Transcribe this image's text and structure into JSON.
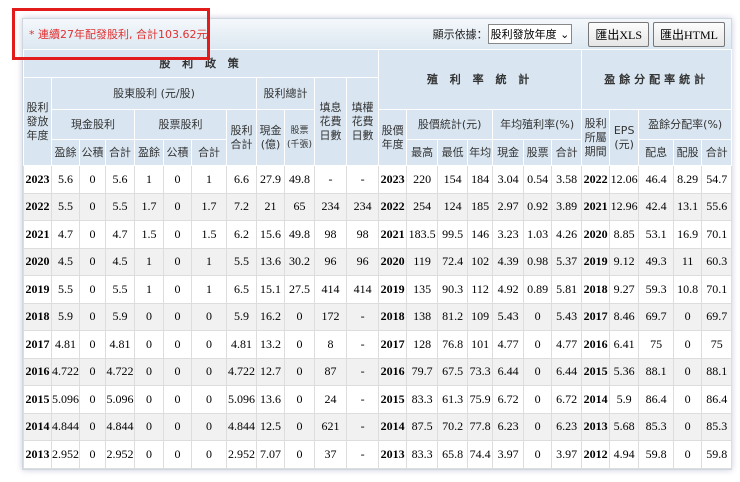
{
  "note": "* 連續27年配發股利, 合計103.62元",
  "display_label": "顯示依據：",
  "display_value": "股利發放年度",
  "btn_xls": "匯出XLS",
  "btn_html": "匯出HTML",
  "headers": {
    "policy": "股 利 政 策",
    "yield_stats": "殖 利 率 統 計",
    "payout_stats": "盈餘分配率統計",
    "pay_year": "股利發放年度",
    "holder_div": "股東股利 (元/股)",
    "div_total": "股利總計",
    "fill_div": "填息花費日數",
    "fill_right": "填權花費日數",
    "cash_div": "現金股利",
    "stock_div": "股票股利",
    "div_sum": "股利合計",
    "cash_yi": "現金(億)",
    "stock_k": "股票(千張)",
    "price_year": "股價年度",
    "price_stats": "股價統計(元)",
    "avg_yield": "年均殖利率(%)",
    "period": "股利所屬期間",
    "eps": "EPS (元)",
    "payout": "盈餘分配率(%)",
    "earn": "盈餘",
    "reserve": "公積",
    "total": "合計",
    "high": "最高",
    "low": "最低",
    "avg": "年均",
    "cash": "現金",
    "stock": "股票",
    "pay_cash": "配息",
    "pay_stock": "配股"
  },
  "rows": [
    [
      "2023",
      "5.6",
      "0",
      "5.6",
      "1",
      "0",
      "1",
      "6.6",
      "27.9",
      "49.8",
      "-",
      "-",
      "2023",
      "220",
      "154",
      "184",
      "3.04",
      "0.54",
      "3.58",
      "2022",
      "12.06",
      "46.4",
      "8.29",
      "54.7"
    ],
    [
      "2022",
      "5.5",
      "0",
      "5.5",
      "1.7",
      "0",
      "1.7",
      "7.2",
      "21",
      "65",
      "234",
      "234",
      "2022",
      "254",
      "124",
      "185",
      "2.97",
      "0.92",
      "3.89",
      "2021",
      "12.96",
      "42.4",
      "13.1",
      "55.6"
    ],
    [
      "2021",
      "4.7",
      "0",
      "4.7",
      "1.5",
      "0",
      "1.5",
      "6.2",
      "15.6",
      "49.8",
      "98",
      "98",
      "2021",
      "183.5",
      "99.5",
      "146",
      "3.23",
      "1.03",
      "4.26",
      "2020",
      "8.85",
      "53.1",
      "16.9",
      "70.1"
    ],
    [
      "2020",
      "4.5",
      "0",
      "4.5",
      "1",
      "0",
      "1",
      "5.5",
      "13.6",
      "30.2",
      "96",
      "96",
      "2020",
      "119",
      "72.4",
      "102",
      "4.39",
      "0.98",
      "5.37",
      "2019",
      "9.12",
      "49.3",
      "11",
      "60.3"
    ],
    [
      "2019",
      "5.5",
      "0",
      "5.5",
      "1",
      "0",
      "1",
      "6.5",
      "15.1",
      "27.5",
      "414",
      "414",
      "2019",
      "135",
      "90.3",
      "112",
      "4.92",
      "0.89",
      "5.81",
      "2018",
      "9.27",
      "59.3",
      "10.8",
      "70.1"
    ],
    [
      "2018",
      "5.9",
      "0",
      "5.9",
      "0",
      "0",
      "0",
      "5.9",
      "16.2",
      "0",
      "172",
      "-",
      "2018",
      "138",
      "81.2",
      "109",
      "5.43",
      "0",
      "5.43",
      "2017",
      "8.46",
      "69.7",
      "0",
      "69.7"
    ],
    [
      "2017",
      "4.81",
      "0",
      "4.81",
      "0",
      "0",
      "0",
      "4.81",
      "13.2",
      "0",
      "8",
      "-",
      "2017",
      "128",
      "76.8",
      "101",
      "4.77",
      "0",
      "4.77",
      "2016",
      "6.41",
      "75",
      "0",
      "75"
    ],
    [
      "2016",
      "4.722",
      "0",
      "4.722",
      "0",
      "0",
      "0",
      "4.722",
      "12.7",
      "0",
      "87",
      "-",
      "2016",
      "79.7",
      "67.5",
      "73.3",
      "6.44",
      "0",
      "6.44",
      "2015",
      "5.36",
      "88.1",
      "0",
      "88.1"
    ],
    [
      "2015",
      "5.096",
      "0",
      "5.096",
      "0",
      "0",
      "0",
      "5.096",
      "13.6",
      "0",
      "24",
      "-",
      "2015",
      "83.3",
      "61.3",
      "75.9",
      "6.72",
      "0",
      "6.72",
      "2014",
      "5.9",
      "86.4",
      "0",
      "86.4"
    ],
    [
      "2014",
      "4.844",
      "0",
      "4.844",
      "0",
      "0",
      "0",
      "4.844",
      "12.5",
      "0",
      "621",
      "-",
      "2014",
      "87.5",
      "70.2",
      "77.8",
      "6.23",
      "0",
      "6.23",
      "2013",
      "5.68",
      "85.3",
      "0",
      "85.3"
    ],
    [
      "2013",
      "2.952",
      "0",
      "2.952",
      "0",
      "0",
      "0",
      "2.952",
      "7.07",
      "0",
      "37",
      "-",
      "2013",
      "83.3",
      "65.8",
      "74.4",
      "3.97",
      "0",
      "3.97",
      "2012",
      "4.94",
      "59.8",
      "0",
      "59.8"
    ]
  ]
}
